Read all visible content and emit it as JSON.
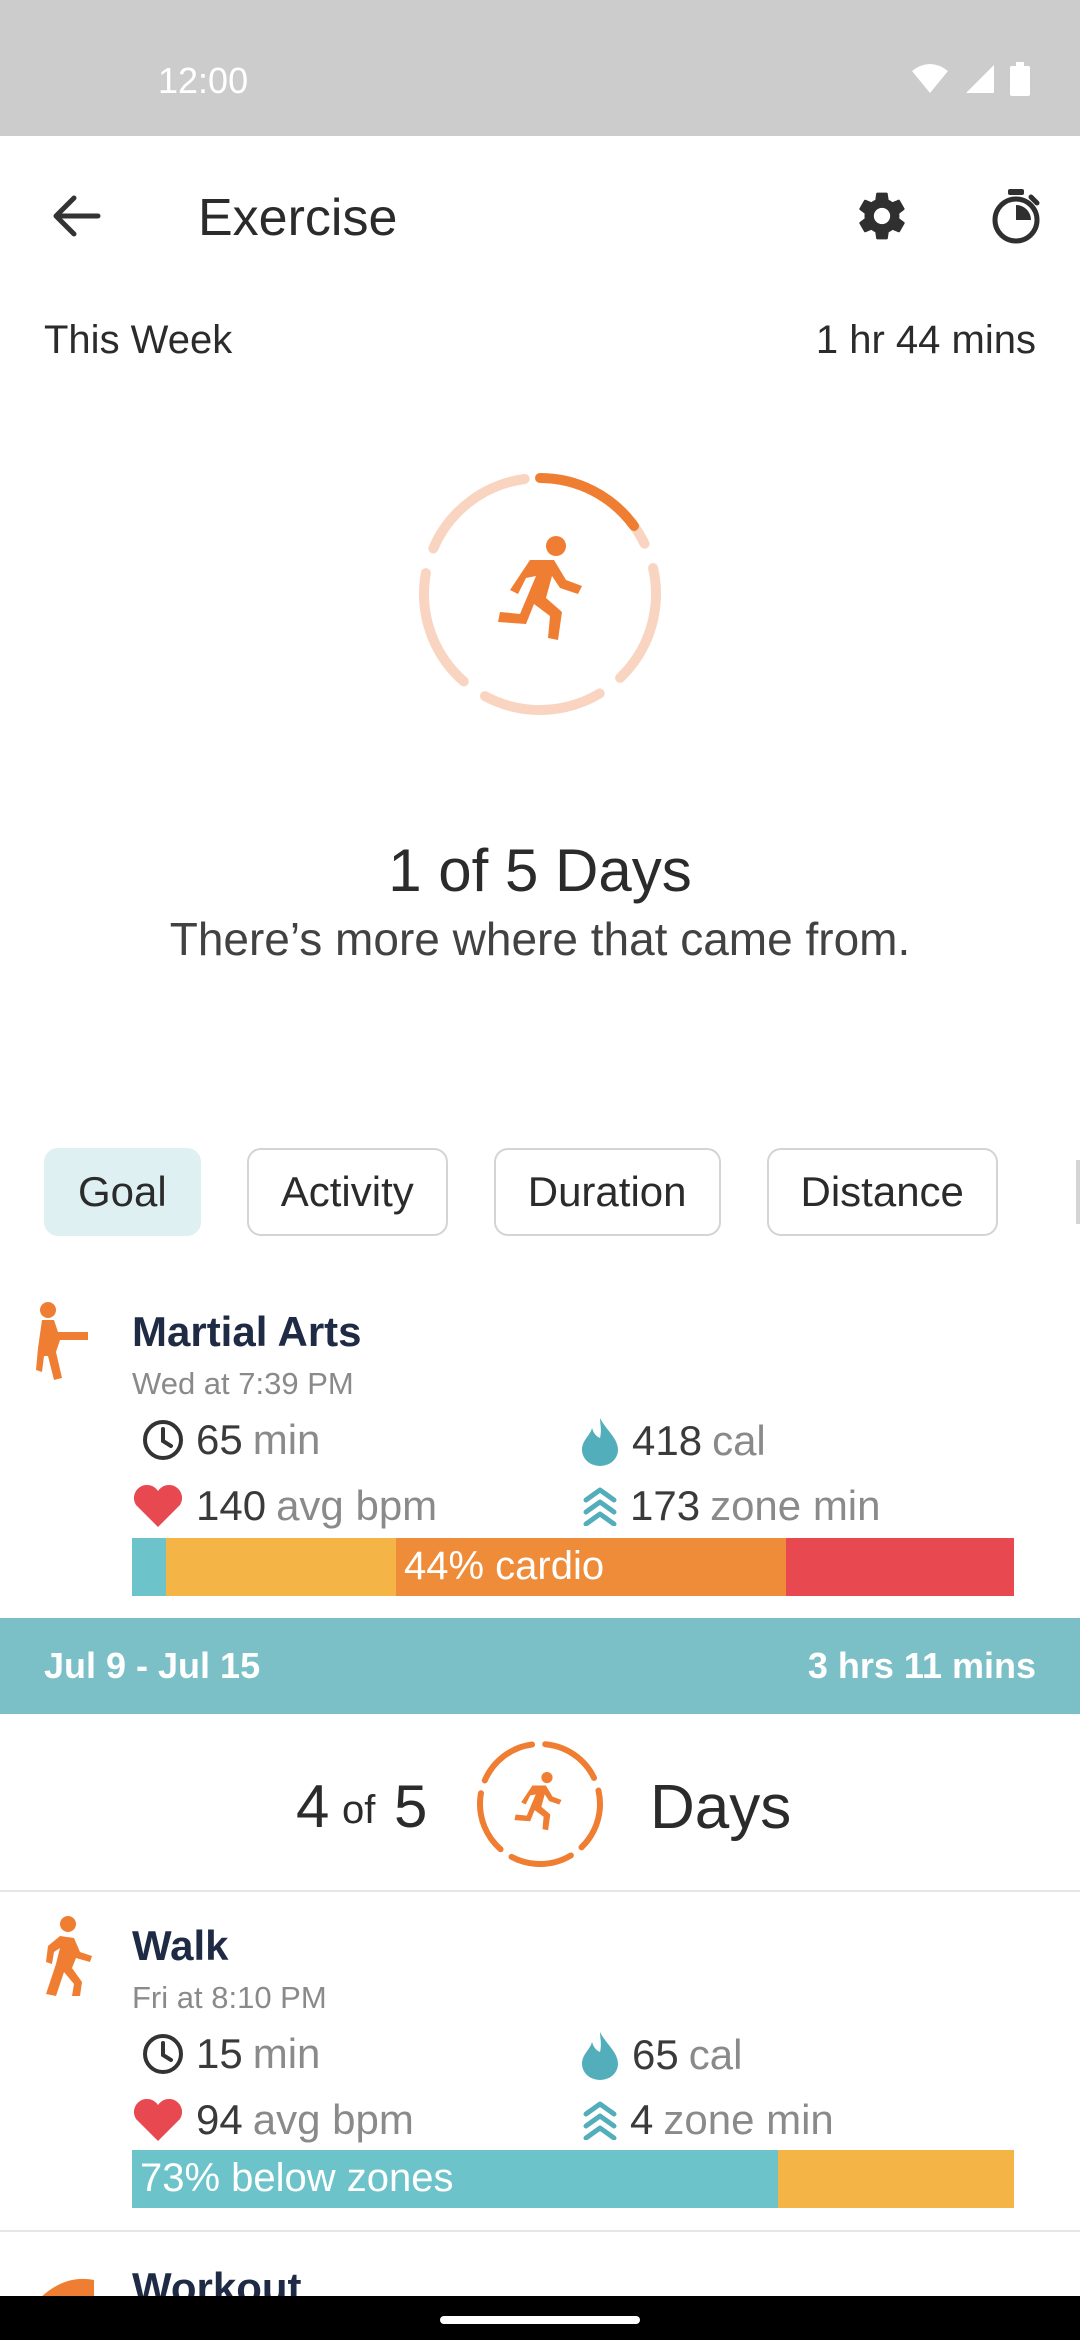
{
  "status_bar": {
    "time": "12:00"
  },
  "app_bar": {
    "title": "Exercise"
  },
  "this_week": {
    "label": "This Week",
    "total": "1 hr 44 mins"
  },
  "goal": {
    "title": "1 of 5 Days",
    "subtitle": "There’s more where that came from.",
    "progress_days": 1,
    "goal_days": 5
  },
  "chips": [
    "Goal",
    "Activity",
    "Duration",
    "Distance"
  ],
  "activities": [
    {
      "name": "Martial Arts",
      "time": "Wed at 7:39 PM",
      "duration_num": "65",
      "duration_unit": "min",
      "cal_num": "418",
      "cal_unit": "cal",
      "bpm_num": "140",
      "bpm_unit": "avg bpm",
      "zone_num": "173",
      "zone_unit": "zone min",
      "bar_label": "44% cardio"
    },
    {
      "name": "Walk",
      "time": "Fri at 8:10 PM",
      "duration_num": "15",
      "duration_unit": "min",
      "cal_num": "65",
      "cal_unit": "cal",
      "bpm_num": "94",
      "bpm_unit": "avg bpm",
      "zone_num": "4",
      "zone_unit": "zone min",
      "bar_label": "73% below zones"
    },
    {
      "name": "Workout"
    }
  ],
  "prev_week": {
    "range": "Jul 9 - Jul 15",
    "total": "3 hrs 11 mins",
    "num": "4",
    "of": "of",
    "goal": "5",
    "days_label": "Days"
  },
  "colors": {
    "accent": "#ef7e33",
    "ring_light": "#f9d5c1",
    "teal": "#6cc3c9",
    "yellow": "#f5b446",
    "orange": "#ee8c3a",
    "red": "#e8484f"
  }
}
